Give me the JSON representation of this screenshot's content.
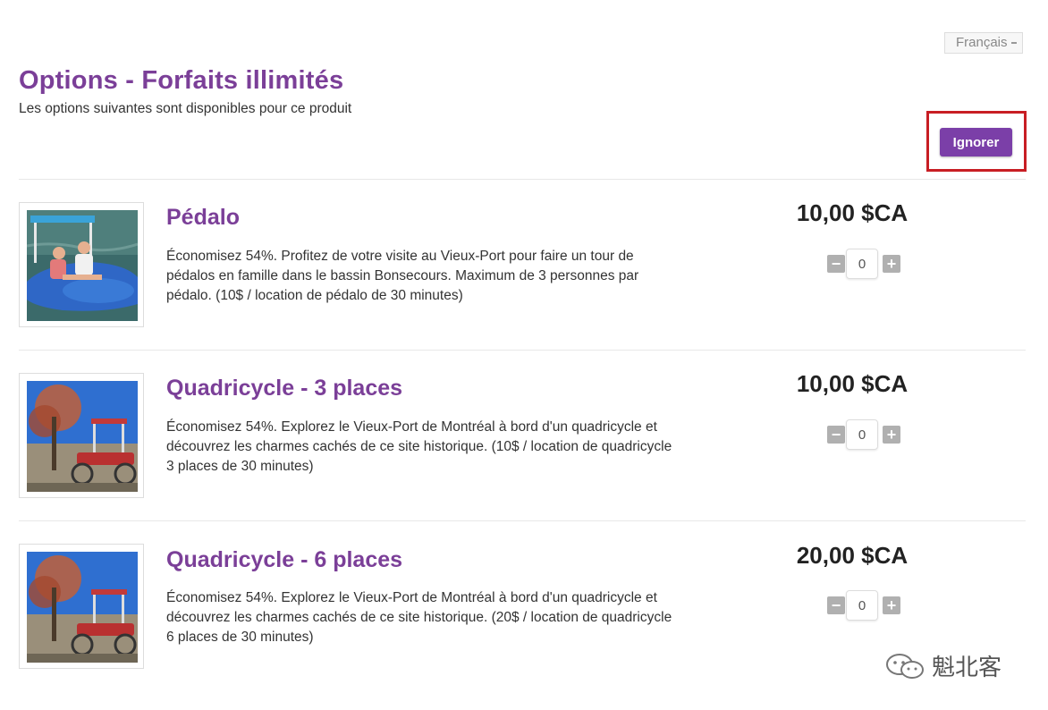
{
  "language": {
    "selected": "Français"
  },
  "header": {
    "title": "Options - Forfaits illimités",
    "subtitle": "Les options suivantes sont disponibles pour ce produit",
    "ignore_label": "Ignorer"
  },
  "items": [
    {
      "title": "Pédalo",
      "description": "Économisez 54%. Profitez de votre visite au Vieux-Port pour faire un tour de pédalos en famille dans le bassin Bonsecours. Maximum de 3 personnes par pédalo. (10$ / location de pédalo de 30 minutes)",
      "price": "10,00 $CA",
      "quantity": "0",
      "image": "pedal-boat-photo"
    },
    {
      "title": "Quadricycle - 3 places",
      "description": "Économisez 54%. Explorez le Vieux-Port de Montréal à bord d'un quadricycle et découvrez les charmes cachés de ce site historique. (10$ / location de quadricycle 3 places de 30 minutes)",
      "price": "10,00 $CA",
      "quantity": "0",
      "image": "quadricycle-photo"
    },
    {
      "title": "Quadricycle - 6 places",
      "description": "Économisez 54%. Explorez le Vieux-Port de Montréal à bord d'un quadricycle et découvrez les charmes cachés de ce site historique. (20$ / location de quadricycle 6 places de 30 minutes)",
      "price": "20,00 $CA",
      "quantity": "0",
      "image": "quadricycle-photo"
    }
  ],
  "stepper": {
    "minus": "−",
    "plus": "+"
  },
  "watermark": {
    "text": "魁北客"
  },
  "colors": {
    "brand": "#7b3f98",
    "button": "#7b3fa8",
    "highlight": "#c81e24"
  }
}
